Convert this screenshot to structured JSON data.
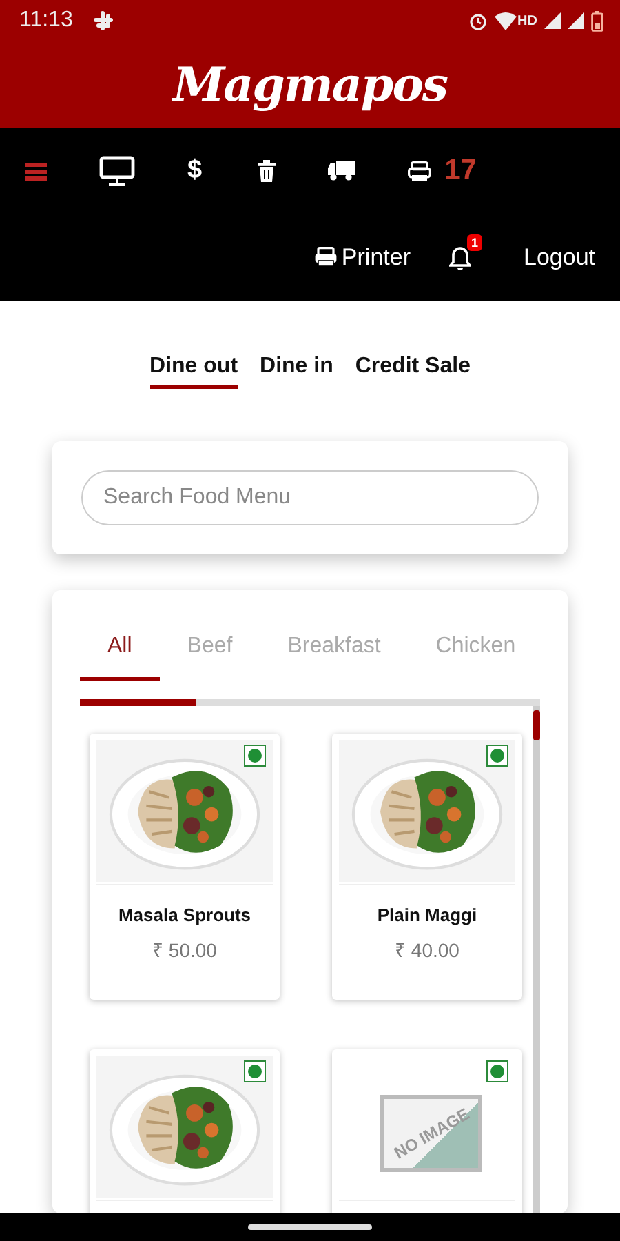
{
  "status_bar": {
    "time": "11:13",
    "network": "HD"
  },
  "header": {
    "logo": "Magmapos"
  },
  "toolbar": {
    "items": [
      {
        "kind": "menu"
      },
      {
        "kind": "monitor"
      },
      {
        "kind": "dollar",
        "label": "$"
      },
      {
        "kind": "trash"
      },
      {
        "kind": "truck"
      },
      {
        "kind": "printer",
        "count": "17"
      }
    ],
    "actions": [
      {
        "kind": "printer",
        "label": "Printer"
      },
      {
        "kind": "bell",
        "badge": "1"
      },
      {
        "kind": "link",
        "label": "Logout"
      }
    ]
  },
  "order_tabs": [
    {
      "label": "Dine out",
      "selected": true
    },
    {
      "label": "Dine in",
      "selected": false
    },
    {
      "label": "Credit Sale",
      "selected": false
    }
  ],
  "search": {
    "placeholder": "Search Food Menu"
  },
  "category_tabs": [
    {
      "label": "All",
      "selected": true
    },
    {
      "label": "Beef",
      "selected": false
    },
    {
      "label": "Breakfast",
      "selected": false
    },
    {
      "label": "Chicken",
      "selected": false
    }
  ],
  "items": [
    {
      "name": "Masala Sprouts",
      "price": "₹ 50.00",
      "veg": true
    },
    {
      "name": "Plain Maggi",
      "price": "₹ 40.00",
      "veg": true
    },
    {
      "veg": true
    },
    {
      "veg": true,
      "image": {
        "kind": "no_image",
        "label": "NO IMAGE"
      }
    }
  ]
}
